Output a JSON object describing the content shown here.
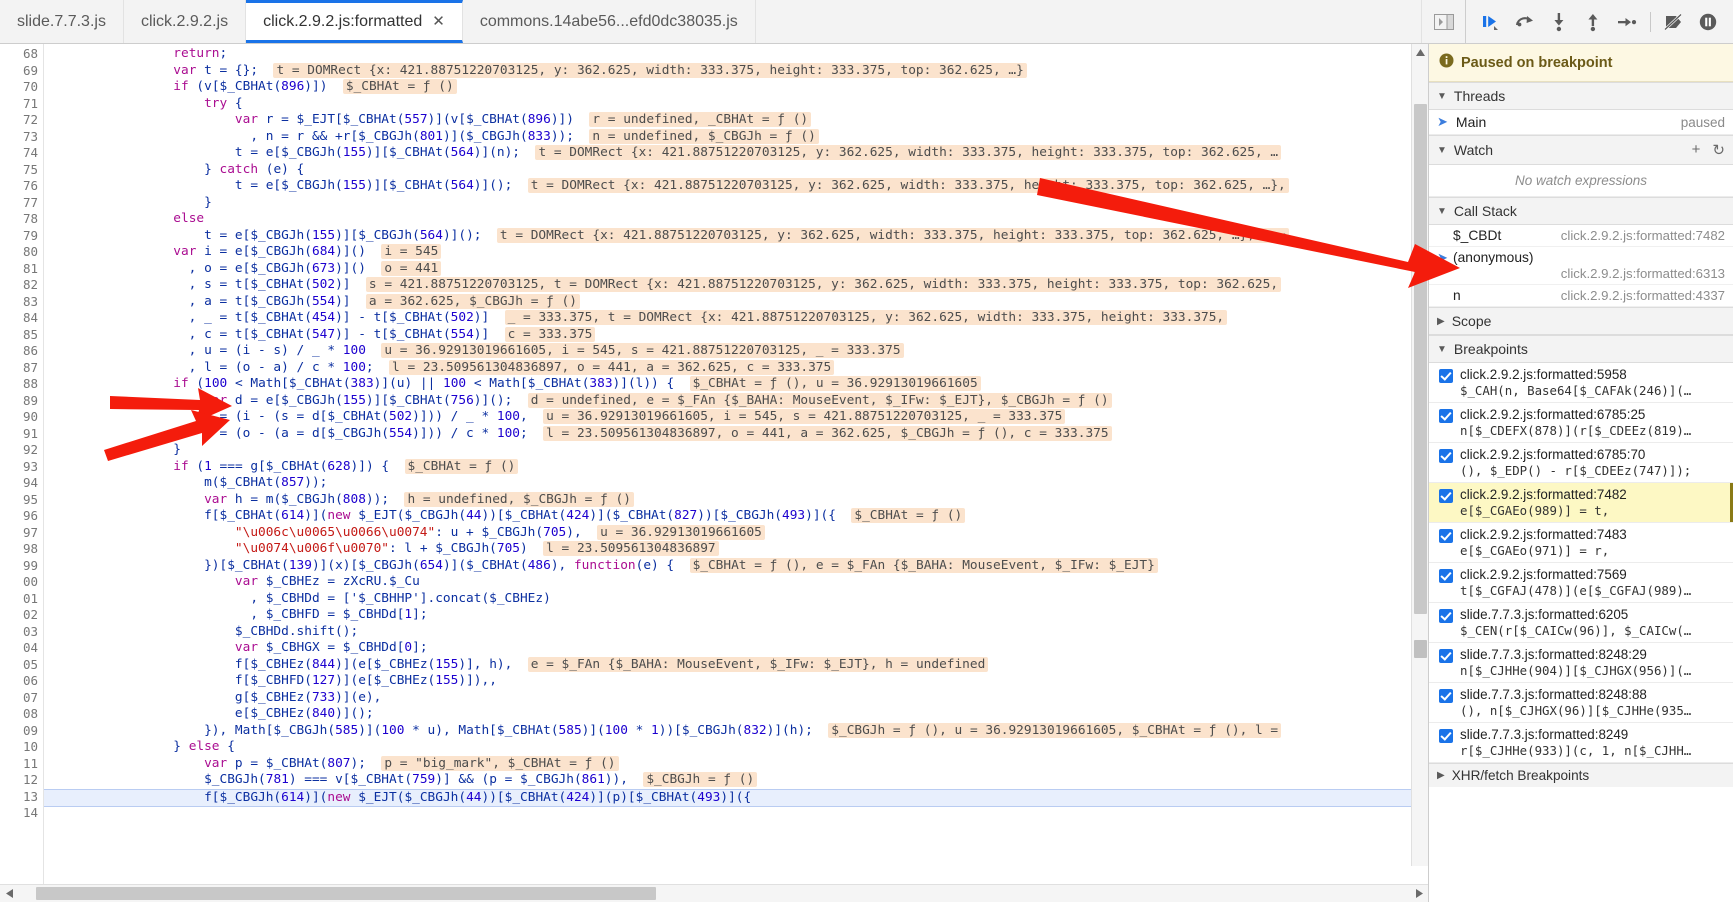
{
  "tabs": [
    {
      "label": "slide.7.7.3.js",
      "active": false,
      "closable": false
    },
    {
      "label": "click.2.9.2.js",
      "active": false,
      "closable": false
    },
    {
      "label": "click.2.9.2.js:formatted",
      "active": true,
      "closable": true,
      "close_glyph": "✕"
    },
    {
      "label": "commons.14abe56...efd0dc38035.js",
      "active": false,
      "closable": false
    }
  ],
  "toolbar": {
    "panel_toggle_icon": "show-panel-icon",
    "buttons": [
      {
        "name": "resume-script-execution-button",
        "icon": "resume-icon"
      },
      {
        "name": "step-over-next-function-call-button",
        "icon": "step-over-icon"
      },
      {
        "name": "step-into-next-function-call-button",
        "icon": "step-into-icon"
      },
      {
        "name": "step-out-of-current-function-button",
        "icon": "step-out-icon"
      },
      {
        "name": "step-button",
        "icon": "step-icon"
      },
      {
        "name": "deactivate-breakpoints-button",
        "icon": "deactivate-breakpoints-icon"
      },
      {
        "name": "pause-on-exceptions-button",
        "icon": "pause-on-exceptions-icon"
      }
    ]
  },
  "editor": {
    "first_line_number": 68,
    "current_line_index": 45,
    "lines": [
      {
        "n": "68",
        "code": "                return;"
      },
      {
        "n": "69",
        "code": "                var t = {};",
        "blob": "t = DOMRect {x: 421.88751220703125, y: 362.625, width: 333.375, height: 333.375, top: 362.625, …}"
      },
      {
        "n": "70",
        "code": "                if (v[$_CBHAt(896)])",
        "blob": "$_CBHAt = ƒ ()"
      },
      {
        "n": "71",
        "code": "                    try {"
      },
      {
        "n": "72",
        "code": "                        var r = $_EJT[$_CBHAt(557)](v[$_CBHAt(896)])",
        "blob": "r = undefined, _CBHAt = ƒ ()"
      },
      {
        "n": "73",
        "code": "                          , n = r && +r[$_CBGJh(801)]($_CBGJh(833));",
        "blob": "n = undefined, $_CBGJh = ƒ ()"
      },
      {
        "n": "74",
        "code": "                        t = e[$_CBGJh(155)][$_CBHAt(564)](n);",
        "blob": "t = DOMRect {x: 421.88751220703125, y: 362.625, width: 333.375, height: 333.375, top: 362.625, …"
      },
      {
        "n": "75",
        "code": "                    } catch (e) {"
      },
      {
        "n": "76",
        "code": "                        t = e[$_CBGJh(155)][$_CBHAt(564)]();",
        "blob": "t = DOMRect {x: 421.88751220703125, y: 362.625, width: 333.375, height: 333.375, top: 362.625, …},"
      },
      {
        "n": "77",
        "code": "                    }"
      },
      {
        "n": "78",
        "code": "                else"
      },
      {
        "n": "79",
        "code": "                    t = e[$_CBGJh(155)][$_CBGJh(564)]();",
        "blob": "t = DOMRect {x: 421.88751220703125, y: 362.625, width: 333.375, height: 333.375, top: 362.625, …}, e ="
      },
      {
        "n": "80",
        "code": "                var i = e[$_CBGJh(684)]()",
        "blob": "i = 545"
      },
      {
        "n": "81",
        "code": "                  , o = e[$_CBGJh(673)]()",
        "blob": "o = 441"
      },
      {
        "n": "82",
        "code": "                  , s = t[$_CBHAt(502)]",
        "blob": "s = 421.88751220703125, t = DOMRect {x: 421.88751220703125, y: 362.625, width: 333.375, height: 333.375, top: 362.625,"
      },
      {
        "n": "83",
        "code": "                  , a = t[$_CBGJh(554)]",
        "blob": "a = 362.625, $_CBGJh = ƒ ()"
      },
      {
        "n": "84",
        "code": "                  , _ = t[$_CBHAt(454)] - t[$_CBHAt(502)]",
        "blob": "_ = 333.375, t = DOMRect {x: 421.88751220703125, y: 362.625, width: 333.375, height: 333.375,"
      },
      {
        "n": "85",
        "code": "                  , c = t[$_CBHAt(547)] - t[$_CBHAt(554)]",
        "blob": "c = 333.375"
      },
      {
        "n": "86",
        "code": "                  , u = (i - s) / _ * 100",
        "blob": "u = 36.92913019661605, i = 545, s = 421.88751220703125, _ = 333.375"
      },
      {
        "n": "87",
        "code": "                  , l = (o - a) / c * 100;",
        "blob": "l = 23.509561304836897, o = 441, a = 362.625, c = 333.375"
      },
      {
        "n": "88",
        "code": "                if (100 < Math[$_CBHAt(383)](u) || 100 < Math[$_CBHAt(383)](l)) {",
        "blob": "$_CBHAt = ƒ (), u = 36.92913019661605"
      },
      {
        "n": "89",
        "code": "                    var d = e[$_CBGJh(155)][$_CBHAt(756)]();",
        "blob": "d = undefined, e = $_FAn {$_BAHA: MouseEvent, $_IFw: $_EJT}, $_CBGJh = ƒ ()"
      },
      {
        "n": "90",
        "code": "                    u = (i - (s = d[$_CBHAt(502)])) / _ * 100,",
        "blob": "u = 36.92913019661605, i = 545, s = 421.88751220703125, _ = 333.375"
      },
      {
        "n": "91",
        "code": "                    l = (o - (a = d[$_CBGJh(554)])) / c * 100;",
        "blob": "l = 23.509561304836897, o = 441, a = 362.625, $_CBGJh = ƒ (), c = 333.375"
      },
      {
        "n": "92",
        "code": "                }"
      },
      {
        "n": "93",
        "code": "                if (1 === g[$_CBHAt(628)]) {",
        "blob": "$_CBHAt = ƒ ()"
      },
      {
        "n": "94",
        "code": "                    m($_CBHAt(857));"
      },
      {
        "n": "95",
        "code": "                    var h = m($_CBGJh(808));",
        "blob": "h = undefined, $_CBGJh = ƒ ()"
      },
      {
        "n": "96",
        "code": "                    f[$_CBHAt(614)](new $_EJT($_CBGJh(44))[$_CBHAt(424)]($_CBHAt(827))[$_CBGJh(493)]({",
        "blob": "$_CBHAt = ƒ ()"
      },
      {
        "n": "97",
        "code": "                        \"\\u006c\\u0065\\u0066\\u0074\": u + $_CBGJh(705),",
        "blob": "u = 36.92913019661605"
      },
      {
        "n": "98",
        "code": "                        \"\\u0074\\u006f\\u0070\": l + $_CBGJh(705)",
        "blob": "l = 23.509561304836897"
      },
      {
        "n": "99",
        "code": "                    })[$_CBHAt(139)](x)[$_CBGJh(654)]($_CBHAt(486), function(e) {",
        "blob": "$_CBHAt = ƒ (), e = $_FAn {$_BAHA: MouseEvent, $_IFw: $_EJT}"
      },
      {
        "n": "00",
        "code": "                        var $_CBHEz = zXcRU.$_Cu"
      },
      {
        "n": "01",
        "code": "                          , $_CBHDd = ['$_CBHHP'].concat($_CBHEz)"
      },
      {
        "n": "02",
        "code": "                          , $_CBHFD = $_CBHDd[1];"
      },
      {
        "n": "03",
        "code": "                        $_CBHDd.shift();"
      },
      {
        "n": "04",
        "code": "                        var $_CBHGX = $_CBHDd[0];"
      },
      {
        "n": "05",
        "code": "                        f[$_CBHEz(844)](e[$_CBHEz(155)], h),",
        "blob": "e = $_FAn {$_BAHA: MouseEvent, $_IFw: $_EJT}, h = undefined"
      },
      {
        "n": "06",
        "code": "                        f[$_CBHFD(127)](e[$_CBHEz(155)]),,"
      },
      {
        "n": "07",
        "code": "                        g[$_CBHEz(733)](e),"
      },
      {
        "n": "08",
        "code": "                        e[$_CBHEz(840)]();"
      },
      {
        "n": "09",
        "code": "                    }), Math[$_CBGJh(585)](100 * u), Math[$_CBHAt(585)](100 * 1))[$_CBGJh(832)](h);",
        "blob": "$_CBGJh = ƒ (), u = 36.92913019661605, $_CBHAt = ƒ (), l ="
      },
      {
        "n": "10",
        "code": "                } else {"
      },
      {
        "n": "11",
        "code": "                    var p = $_CBHAt(807);",
        "blob": "p = \"big_mark\", $_CBHAt = ƒ ()"
      },
      {
        "n": "12",
        "code": "                    $_CBGJh(781) === v[$_CBHAt(759)] && (p = $_CBGJh(861)),",
        "blob": "$_CBGJh = ƒ ()"
      },
      {
        "n": "13",
        "code": "                    f[$_CBGJh(614)](new $_EJT($_CBGJh(44))[$_CBHAt(424)](p)[$_CBHAt(493)]({"
      },
      {
        "n": "14",
        "code": ""
      }
    ]
  },
  "debug": {
    "paused_banner": {
      "icon": "info-icon",
      "text": "Paused on breakpoint"
    },
    "threads": {
      "title": "Threads",
      "collapse_glyph": "▼",
      "rows": [
        {
          "icon": "blue-arrow-icon",
          "name": "Main",
          "status": "paused"
        }
      ]
    },
    "watch": {
      "title": "Watch",
      "collapse_glyph": "▼",
      "add_glyph": "+",
      "refresh_glyph": "↻",
      "empty_text": "No watch expressions"
    },
    "call_stack": {
      "title": "Call Stack",
      "collapse_glyph": "▼",
      "frames": [
        {
          "name": "$_CBDt",
          "location": "click.2.9.2.js:formatted:7482",
          "selected": false,
          "wrap": false
        },
        {
          "name": "(anonymous)",
          "location": "click.2.9.2.js:formatted:6313",
          "selected": true,
          "wrap": true
        },
        {
          "name": "n",
          "location": "click.2.9.2.js:formatted:4337",
          "selected": false,
          "wrap": false
        }
      ]
    },
    "scope": {
      "title": "Scope",
      "collapse_glyph": "▶"
    },
    "breakpoints": {
      "title": "Breakpoints",
      "collapse_glyph": "▼",
      "items": [
        {
          "checked": true,
          "location": "click.2.9.2.js:formatted:5958",
          "code": "$_CAH(n, Base64[$_CAFAk(246)](…",
          "selected": false
        },
        {
          "checked": true,
          "location": "click.2.9.2.js:formatted:6785:25",
          "code": "n[$_CDEFX(878)](r[$_CDEEz(819)…",
          "selected": false
        },
        {
          "checked": true,
          "location": "click.2.9.2.js:formatted:6785:70",
          "code": "(), $_EDP() - r[$_CDEEz(747)]);",
          "selected": false
        },
        {
          "checked": true,
          "location": "click.2.9.2.js:formatted:7482",
          "code": "e[$_CGAEo(989)] = t,",
          "selected": true
        },
        {
          "checked": true,
          "location": "click.2.9.2.js:formatted:7483",
          "code": "e[$_CGAEo(971)] = r,",
          "selected": false
        },
        {
          "checked": true,
          "location": "click.2.9.2.js:formatted:7569",
          "code": "t[$_CGFAJ(478)](e[$_CGFAJ(989)…",
          "selected": false
        },
        {
          "checked": true,
          "location": "slide.7.7.3.js:formatted:6205",
          "code": "$_CEN(r[$_CAICw(96)], $_CAICw(…",
          "selected": false
        },
        {
          "checked": true,
          "location": "slide.7.7.3.js:formatted:8248:29",
          "code": "n[$_CJHHe(904)][$_CJHGX(956)](…",
          "selected": false
        },
        {
          "checked": true,
          "location": "slide.7.7.3.js:formatted:8248:88",
          "code": "(), n[$_CJHGX(96)][$_CJHHe(935…",
          "selected": false
        },
        {
          "checked": true,
          "location": "slide.7.7.3.js:formatted:8249",
          "code": "r[$_CJHHe(933)](c, 1, n[$_CJHH…",
          "selected": false
        }
      ]
    },
    "xhr": {
      "title": "XHR/fetch Breakpoints",
      "collapse_glyph": "▶"
    }
  },
  "annotations": {
    "arrow_color": "#f41c0c",
    "arrows": [
      {
        "name": "arrow-to-call-stack-anonymous"
      },
      {
        "name": "arrow-to-code-line-90"
      },
      {
        "name": "arrow-to-code-line-91"
      }
    ]
  }
}
